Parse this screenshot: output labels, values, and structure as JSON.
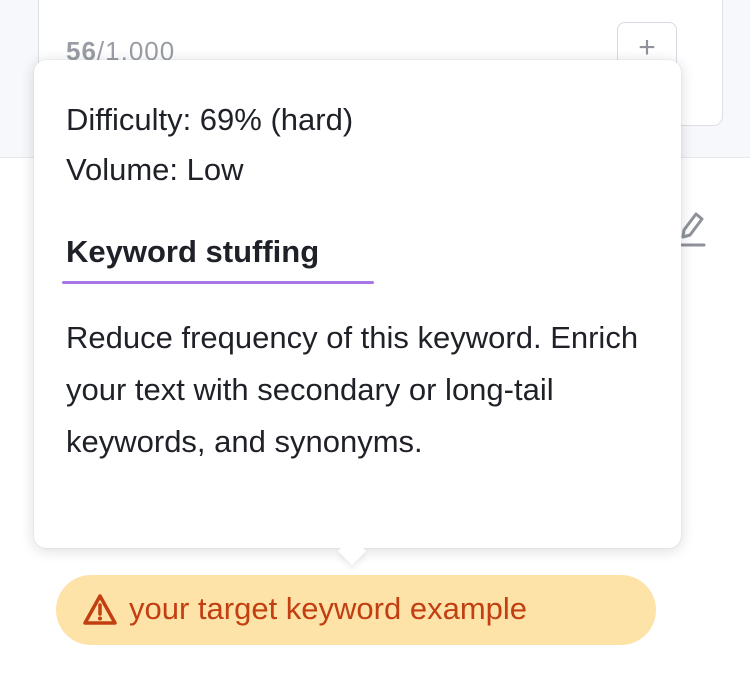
{
  "counter": {
    "current": "56",
    "separator_total": "/1,000",
    "plus_label": "+"
  },
  "tooltip": {
    "difficulty": "Difficulty: 69% (hard)",
    "volume": "Volume: Low",
    "issue_title": "Keyword stuffing",
    "description": "Reduce frequency of this keyword. Enrich your text with secondary or long-tail keywords, and synonyms."
  },
  "keyword_chip": {
    "label": "your target keyword example",
    "icon": "warning-triangle-icon"
  },
  "colors": {
    "accent_underline": "#a875e8",
    "chip_background": "#fde3a8",
    "chip_text": "#c23f12"
  }
}
